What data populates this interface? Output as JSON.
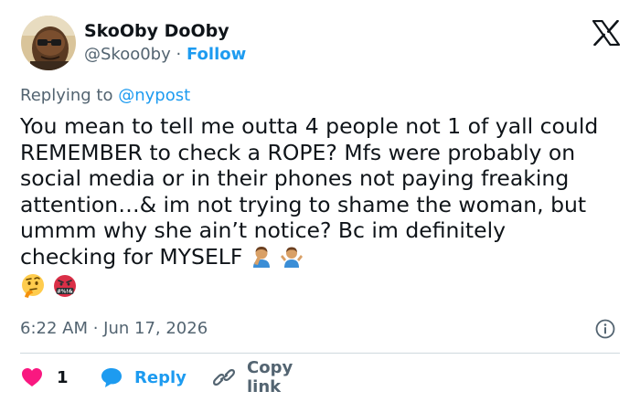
{
  "author": {
    "name": "SkoOby DoOby",
    "handle": "@Skoo0by",
    "separator": "·",
    "follow_label": "Follow"
  },
  "replying": {
    "prefix": "Replying to ",
    "mention": "@nypost"
  },
  "tweet": {
    "text": "You mean to tell me outta 4 people not 1 of yall could REMEMBER to check a ROPE? Mfs were probably on social media or in their phones not paying freaking attention…& im not trying to shame the woman, but ummm why she ain’t notice? Bc im definitely checking for MYSELF",
    "emojis": [
      "man-facepalming",
      "man-shrugging",
      "thinking-face",
      "face-with-symbols-on-mouth"
    ],
    "symbols_text": "#%!&"
  },
  "timestamp": "6:22 AM · Jun 17, 2026",
  "actions": {
    "like_count": "1",
    "reply_label": "Reply",
    "copy_link_label": "Copy link"
  },
  "icons": {
    "logo": "x-logo-icon",
    "info": "info-icon",
    "like": "heart-icon",
    "reply": "speech-bubble-icon",
    "copy": "link-icon"
  },
  "colors": {
    "text": "#0f1419",
    "secondary": "#536471",
    "accent": "#1d9bf0",
    "like": "#f91880",
    "divider": "#cfd9de"
  }
}
